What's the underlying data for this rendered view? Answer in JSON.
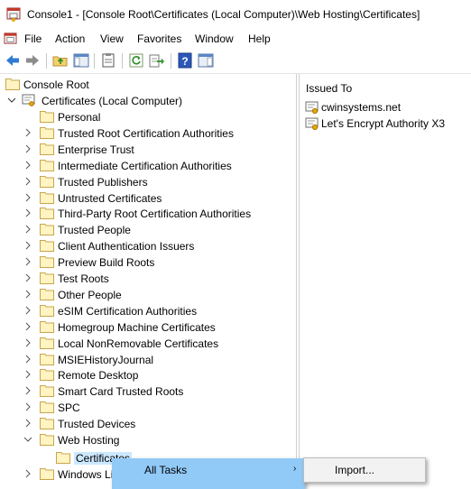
{
  "window": {
    "title": "Console1 - [Console Root\\Certificates (Local Computer)\\Web Hosting\\Certificates]"
  },
  "menu": [
    "File",
    "Action",
    "View",
    "Favorites",
    "Window",
    "Help"
  ],
  "toolbar": [
    "back-icon",
    "forward-icon",
    "up-folder-icon",
    "show-hide-tree-icon",
    "properties-icon",
    "refresh-icon",
    "export-list-icon",
    "help-icon",
    "show-hide-action-pane-icon"
  ],
  "tree": {
    "root": "Console Root",
    "certificates": "Certificates (Local Computer)",
    "stores": [
      "Personal",
      "Trusted Root Certification Authorities",
      "Enterprise Trust",
      "Intermediate Certification Authorities",
      "Trusted Publishers",
      "Untrusted Certificates",
      "Third-Party Root Certification Authorities",
      "Trusted People",
      "Client Authentication Issuers",
      "Preview Build Roots",
      "Test Roots",
      "Other People",
      "eSIM Certification Authorities",
      "Homegroup Machine Certificates",
      "Local NonRemovable Certificates",
      "MSIEHistoryJournal",
      "Remote Desktop",
      "Smart Card Trusted Roots",
      "SPC",
      "Trusted Devices",
      "Web Hosting"
    ],
    "web_hosting_child": "Certificates",
    "after": "Windows Li"
  },
  "list": {
    "column": "Issued To",
    "items": [
      "cwinsystems.net",
      "Let's Encrypt Authority X3"
    ]
  },
  "context_menu": {
    "all_tasks": "All Tasks",
    "arrow": "›",
    "import": "Import..."
  }
}
